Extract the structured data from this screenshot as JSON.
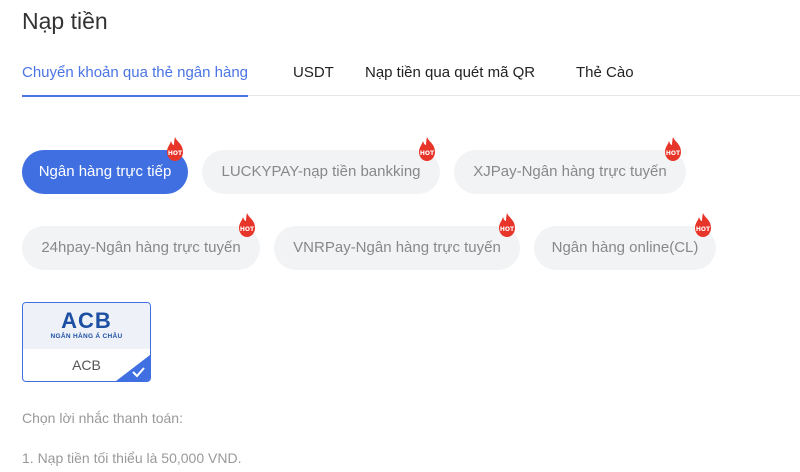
{
  "page": {
    "title": "Nạp tiền"
  },
  "tabs": [
    {
      "label": "Chuyển khoản qua thẻ ngân hàng",
      "active": true
    },
    {
      "label": "USDT",
      "active": false
    },
    {
      "label": "Nạp tiền qua quét mã QR",
      "active": false
    },
    {
      "label": "Thẻ Cào",
      "active": false
    }
  ],
  "methods": [
    {
      "label": "Ngân hàng trực tiếp",
      "active": true,
      "badge": "HOT"
    },
    {
      "label": "LUCKYPAY-nạp tiền bankking",
      "active": false,
      "badge": "HOT"
    },
    {
      "label": "XJPay-Ngân hàng trực tuyến",
      "active": false,
      "badge": "HOT"
    },
    {
      "label": "24hpay-Ngân hàng trực tuyến",
      "active": false,
      "badge": "HOT"
    },
    {
      "label": "VNRPay-Ngân hàng trực tuyến",
      "active": false,
      "badge": "HOT"
    },
    {
      "label": "Ngân hàng online(CL)",
      "active": false,
      "badge": "HOT"
    }
  ],
  "banks": [
    {
      "logo_text": "ACB",
      "logo_subtext": "NGÂN HÀNG Á CHÂU",
      "name": "ACB",
      "selected": true
    }
  ],
  "notice": {
    "title": "Chọn lời nhắc thanh toán:",
    "items": [
      "1. Nạp tiền tối thiểu là 50,000 VND."
    ]
  },
  "colors": {
    "accent": "#3f6fe0",
    "hot_badge": "#e8352a",
    "chip_bg": "#f2f3f5"
  },
  "icons": {
    "badge": "hot-flame-icon",
    "selected": "check-icon"
  }
}
